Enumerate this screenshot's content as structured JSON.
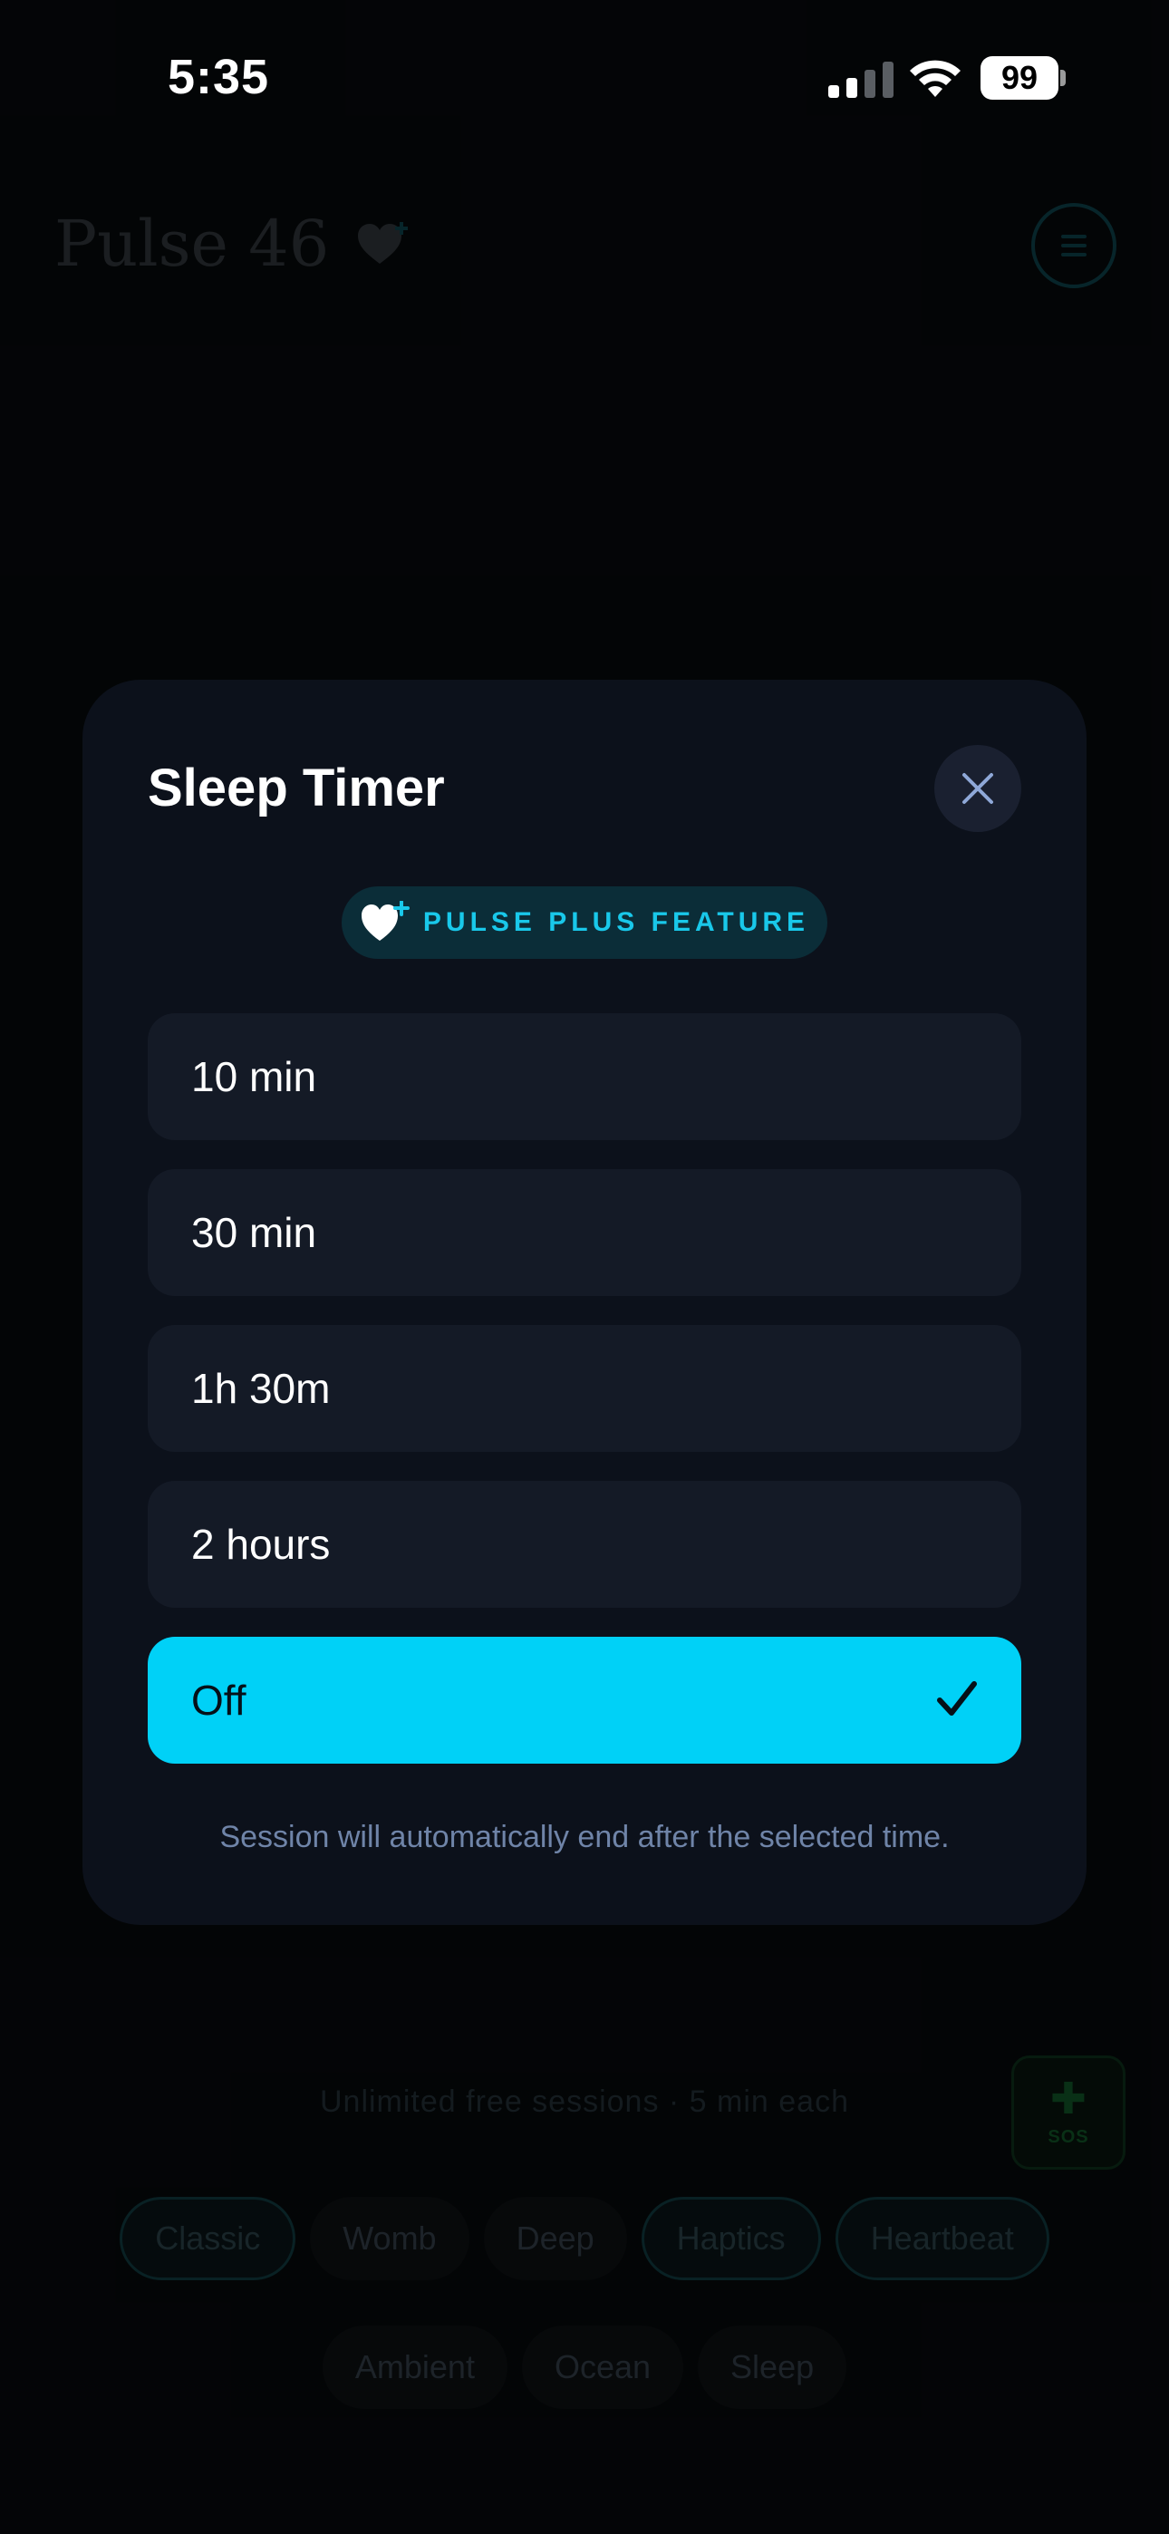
{
  "status_bar": {
    "time": "5:35",
    "battery": "99"
  },
  "background": {
    "brand": "Pulse 46",
    "free_note": "Unlimited free sessions · 5 min each",
    "sos_label": "SOS",
    "chips_row1": [
      "Classic",
      "Womb",
      "Deep",
      "Haptics",
      "Heartbeat"
    ],
    "chips_row2": [
      "Ambient",
      "Ocean",
      "Sleep"
    ]
  },
  "modal": {
    "title": "Sleep Timer",
    "badge": "PULSE PLUS FEATURE",
    "options": [
      "10 min",
      "30 min",
      "1h 30m",
      "2 hours",
      "Off"
    ],
    "selected_option": "Off",
    "footnote": "Session will automatically end after the selected time."
  },
  "colors": {
    "accent": "#00d1f7",
    "modal_bg": "#0c111b",
    "option_bg": "#141a26",
    "badge_text": "#19c8ea"
  }
}
